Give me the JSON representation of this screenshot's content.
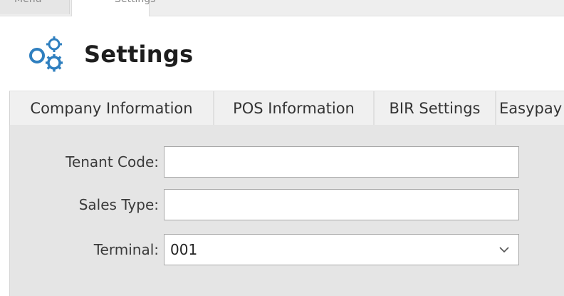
{
  "top_tabs": {
    "menu_label": "Menu",
    "active_label": "Settings"
  },
  "header": {
    "icon": "gears-icon",
    "title": "Settings"
  },
  "tabs": [
    {
      "label": "Company Information"
    },
    {
      "label": "POS Information"
    },
    {
      "label": "BIR Settings"
    },
    {
      "label": "Easypay"
    }
  ],
  "form": {
    "tenant_code": {
      "label": "Tenant Code:",
      "value": ""
    },
    "sales_type": {
      "label": "Sales Type:",
      "value": ""
    },
    "terminal": {
      "label": "Terminal:",
      "value": "001"
    }
  },
  "colors": {
    "icon_blue": "#2f7fbf",
    "panel_bg": "#e5e5e5"
  }
}
